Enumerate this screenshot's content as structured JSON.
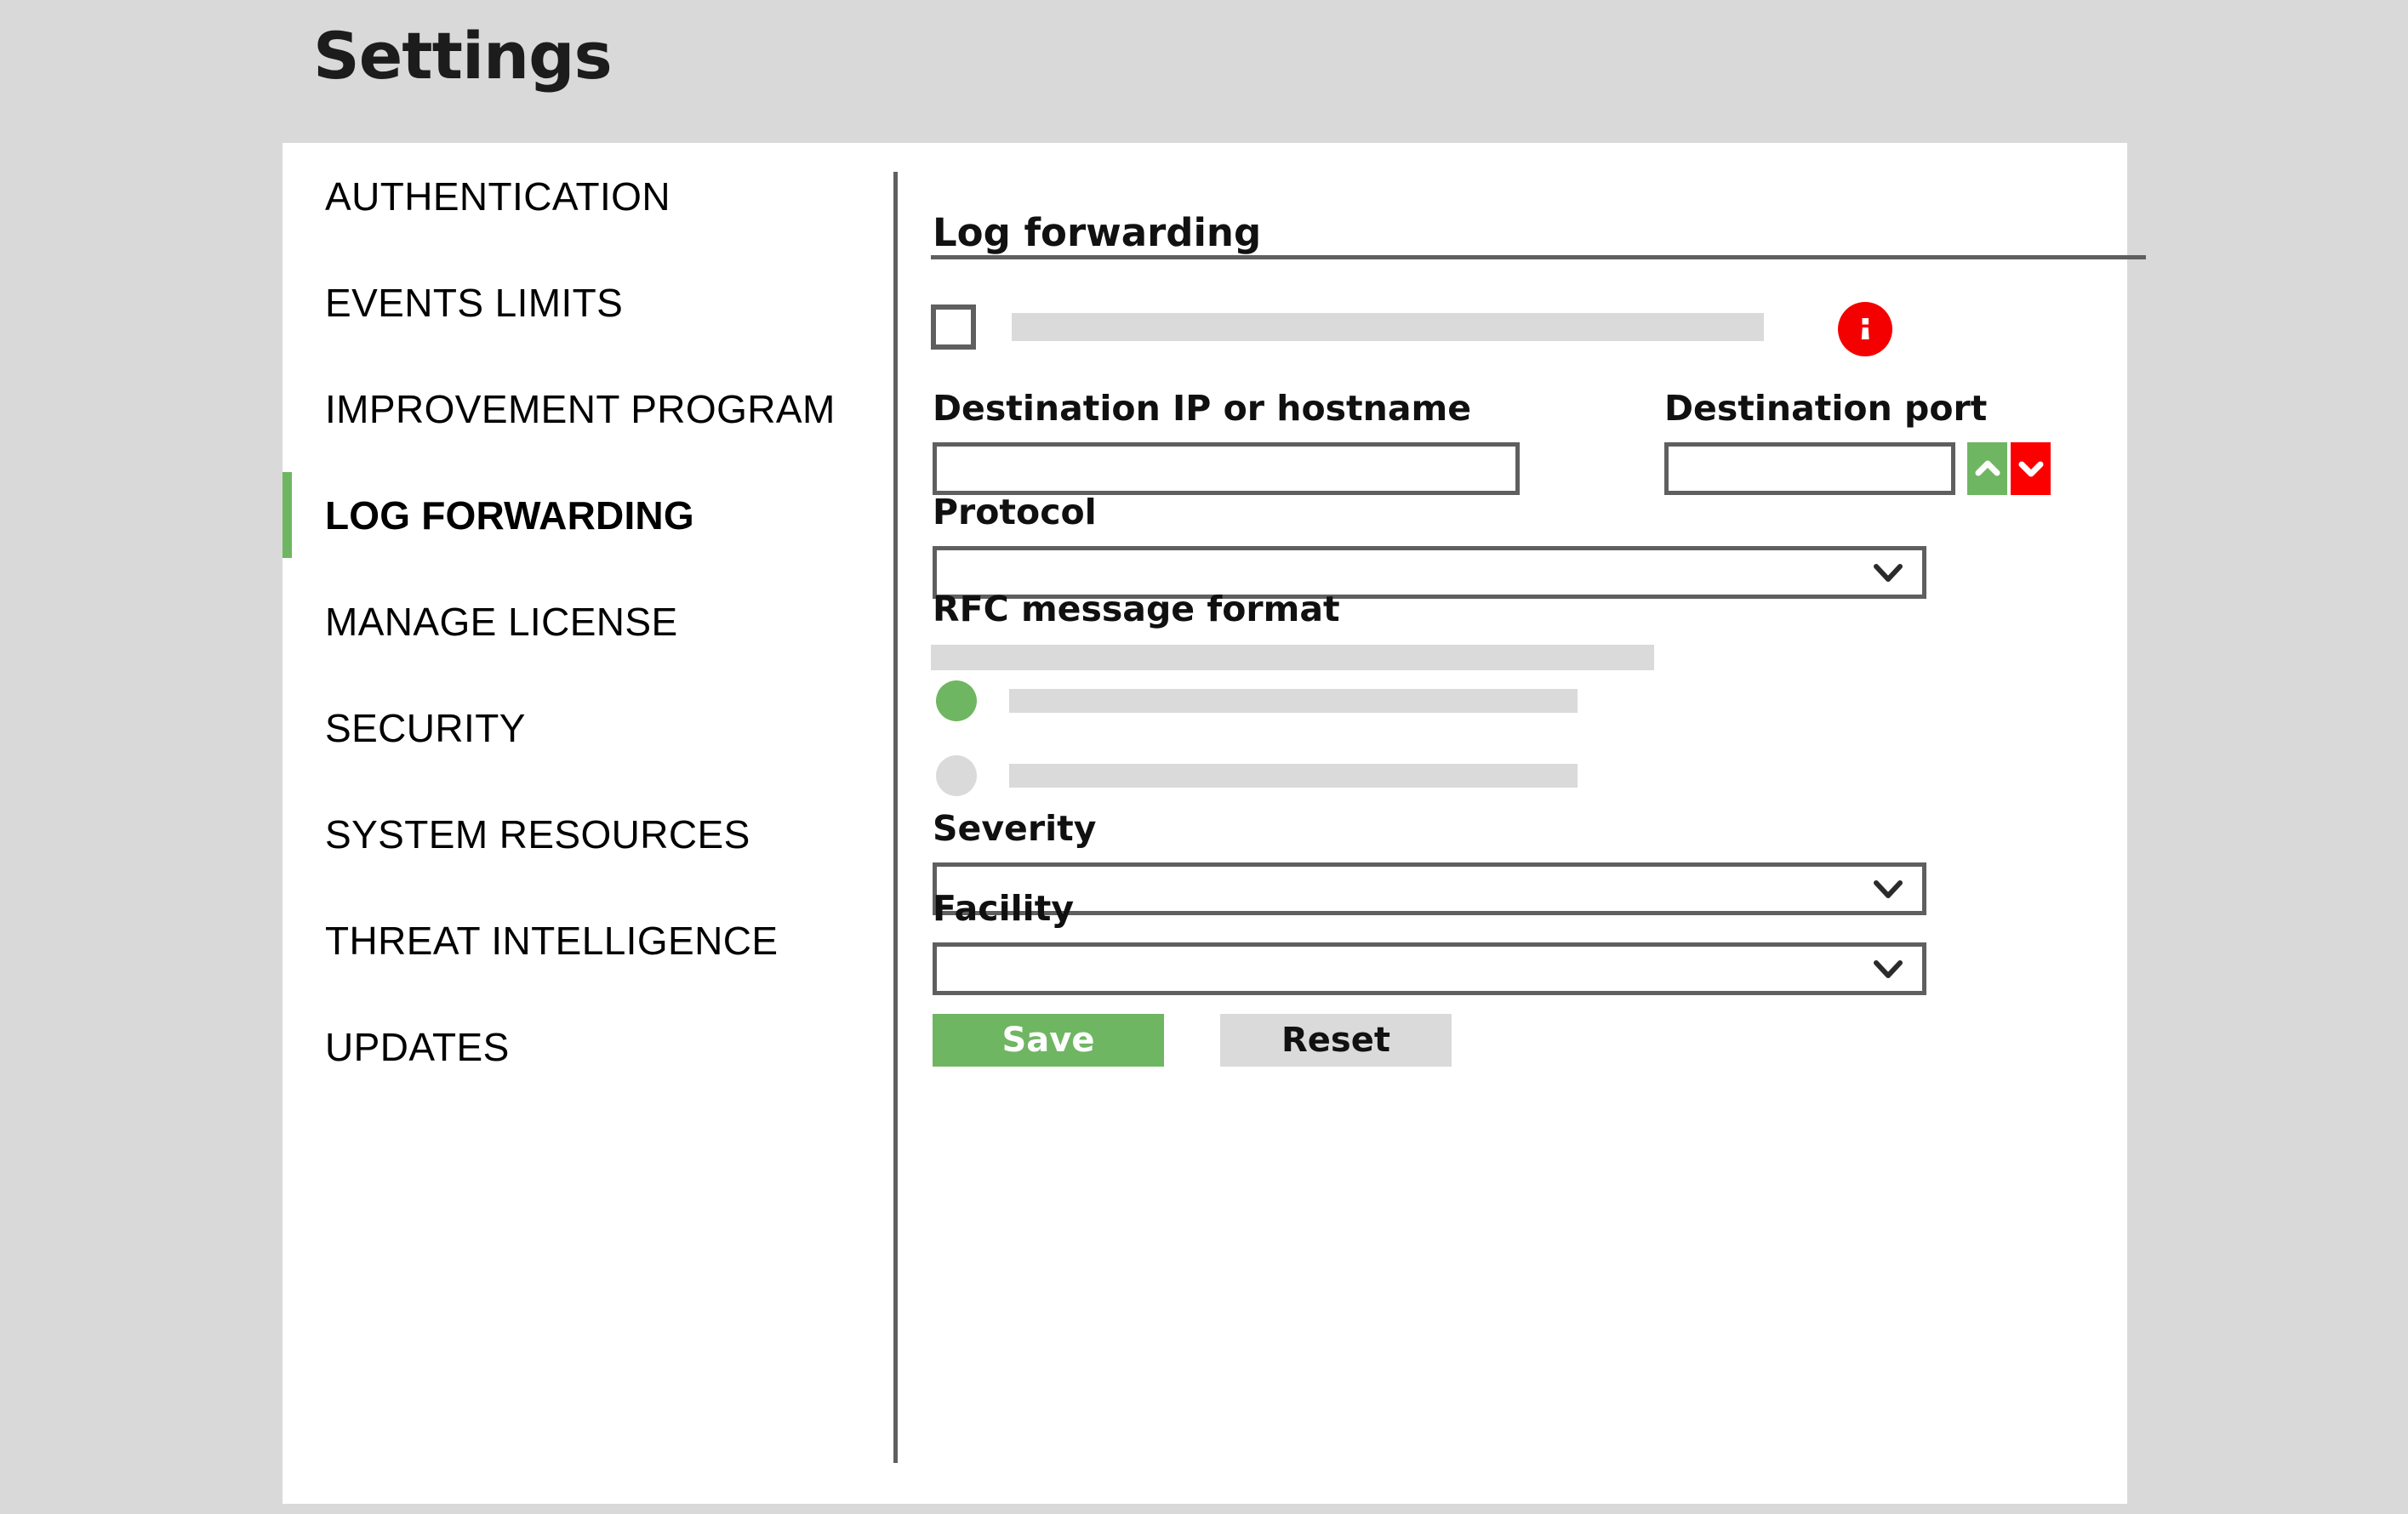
{
  "page": {
    "title": "Settings",
    "background_color": "#d9d9d9",
    "card_background": "#ffffff",
    "accent_green": "#6fb662",
    "alert_red": "#fc0000",
    "border_gray": "#5f5f5f",
    "redacted_gray": "#dadada"
  },
  "sidebar": {
    "items": [
      {
        "label": "AUTHENTICATION",
        "active": false
      },
      {
        "label": "EVENTS LIMITS",
        "active": false
      },
      {
        "label": "IMPROVEMENT PROGRAM",
        "active": false
      },
      {
        "label": "LOG FORWARDING",
        "active": true
      },
      {
        "label": "MANAGE LICENSE",
        "active": false
      },
      {
        "label": "SECURITY",
        "active": false
      },
      {
        "label": "SYSTEM RESOURCES",
        "active": false
      },
      {
        "label": "THREAT INTELLIGENCE",
        "active": false
      },
      {
        "label": "UPDATES",
        "active": false
      }
    ]
  },
  "content": {
    "section_title": "Log forwarding",
    "enable": {
      "checked": false,
      "label_redacted": true,
      "info_icon": "info-icon"
    },
    "destination_ip": {
      "label": "Destination IP or hostname",
      "value": "",
      "placeholder": ""
    },
    "destination_port": {
      "label": "Destination port",
      "value": "",
      "placeholder": "",
      "stepper_up_icon": "chevron-up-icon",
      "stepper_down_icon": "chevron-down-icon"
    },
    "protocol": {
      "label": "Protocol",
      "value": "",
      "dropdown_icon": "chevron-down-icon"
    },
    "rfc_message_format": {
      "label": "RFC message format",
      "description_redacted": true,
      "options": [
        {
          "label_redacted": true,
          "selected": true
        },
        {
          "label_redacted": true,
          "selected": false
        }
      ]
    },
    "severity": {
      "label": "Severity",
      "value": "",
      "dropdown_icon": "chevron-down-icon"
    },
    "facility": {
      "label": "Facility",
      "value": "",
      "dropdown_icon": "chevron-down-icon"
    },
    "actions": {
      "save_label": "Save",
      "reset_label": "Reset"
    }
  }
}
